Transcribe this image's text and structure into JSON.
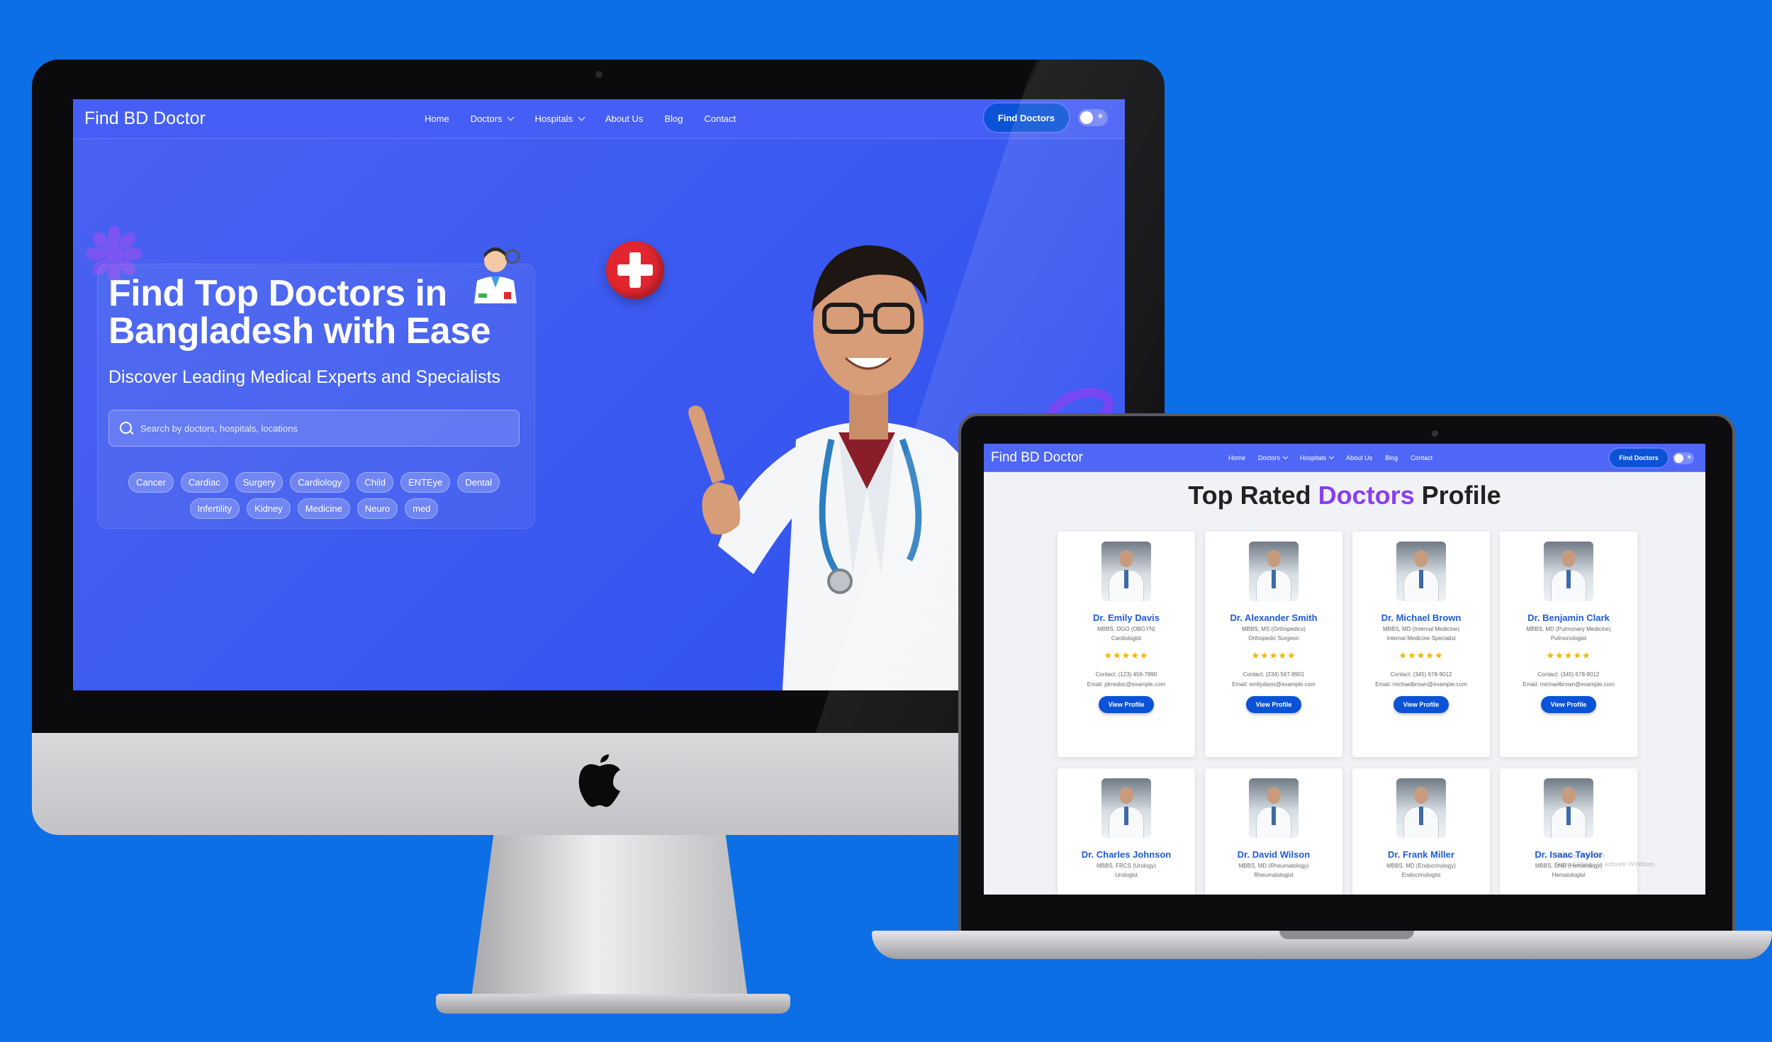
{
  "nav": {
    "brand": "Find BD Doctor",
    "links": [
      {
        "label": "Home",
        "dropdown": false
      },
      {
        "label": "Doctors",
        "dropdown": true
      },
      {
        "label": "Hospitals",
        "dropdown": true
      },
      {
        "label": "About Us",
        "dropdown": false
      },
      {
        "label": "Blog",
        "dropdown": false
      },
      {
        "label": "Contact",
        "dropdown": false
      }
    ],
    "cta": "Find Doctors"
  },
  "hero": {
    "title_line1": "Find Top Doctors in",
    "title_line2": "Bangladesh with Ease",
    "subtitle": "Discover Leading Medical Experts and Specialists",
    "search_placeholder": "Search by doctors, hospitals, locations",
    "tags": [
      "Cancer",
      "Cardiac",
      "Surgery",
      "Cardiology",
      "Child",
      "ENTEye",
      "Dental",
      "Infertility",
      "Kidney",
      "Medicine",
      "Neuro",
      "med"
    ]
  },
  "profiles": {
    "title_before": "Top Rated ",
    "title_accent": "Doctors",
    "title_after": " Profile",
    "accent_color": "#8b3df2",
    "view_label": "View Profile",
    "rating_stars": "★★★★★",
    "doctors": [
      {
        "name": "Dr. Emily Davis",
        "degree": "MBBS, DGO (OBGYN)",
        "specialty": "Cardiologist",
        "contact": "Contact: (123) 456-7890",
        "email": "Email: jdmedoc@example.com"
      },
      {
        "name": "Dr. Alexander Smith",
        "degree": "MBBS, MS (Orthopedics)",
        "specialty": "Orthopedic Surgeon",
        "contact": "Contact: (234) 567-8901",
        "email": "Email: emilydavis@example.com"
      },
      {
        "name": "Dr. Michael Brown",
        "degree": "MBBS, MD (Internal Medicine)",
        "specialty": "Internal Medicine Specialist",
        "contact": "Contact: (345) 678-9012",
        "email": "Email: michaelbrown@example.com"
      },
      {
        "name": "Dr. Benjamin Clark",
        "degree": "MBBS, MD (Pulmonary Medicine)",
        "specialty": "Pulmonologist",
        "contact": "Contact: (345) 678-9012",
        "email": "Email: michaelbrown@example.com"
      },
      {
        "name": "Dr. Charles Johnson",
        "degree": "MBBS, FRCS (Urology)",
        "specialty": "Urologist",
        "contact": "",
        "email": ""
      },
      {
        "name": "Dr. David Wilson",
        "degree": "MBBS, MD (Rheumatology)",
        "specialty": "Rheumatologist",
        "contact": "",
        "email": ""
      },
      {
        "name": "Dr. Frank Miller",
        "degree": "MBBS, MD (Endocrinology)",
        "specialty": "Endocrinologist",
        "contact": "",
        "email": ""
      },
      {
        "name": "Dr. Isaac Taylor",
        "degree": "MBBS, DNB (Hematology)",
        "specialty": "Hematologist",
        "contact": "",
        "email": ""
      }
    ]
  },
  "watermark": {
    "line1": "Activate Windows",
    "line2": "Go to Settings to activate Windows."
  },
  "colors": {
    "background": "#0c6fe6",
    "hero": "#3e5cf0",
    "button": "#0a53d6",
    "link": "#1f5bd8",
    "star": "#f2b600"
  }
}
